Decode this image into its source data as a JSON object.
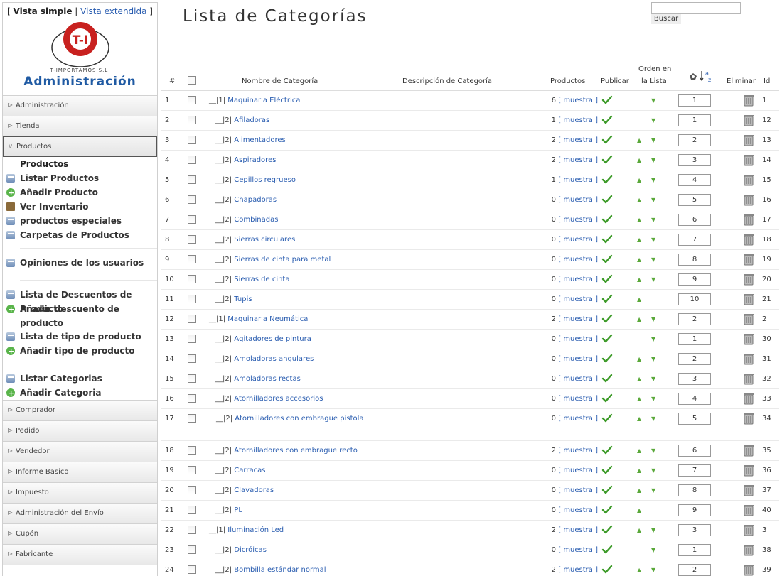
{
  "sidebar": {
    "view_left_bracket": "[",
    "view_simple": "Vista simple",
    "view_sep": "|",
    "view_extended": "Vista extendida",
    "view_right_bracket": "]",
    "logo_text": "T-I",
    "logo_sub": "T-IMPORTAMOS S.L.",
    "admin_title": "Administración",
    "sections_top": [
      {
        "label": "Administración"
      },
      {
        "label": "Tienda"
      }
    ],
    "open_section": "Productos",
    "open_section_title": "Productos",
    "product_items": [
      {
        "label": "Listar Productos",
        "icon": "page-icon"
      },
      {
        "label": "Añadir Producto",
        "icon": "add-icon"
      },
      {
        "label": "Ver Inventario",
        "icon": "inventory-icon"
      },
      {
        "label": "productos especiales",
        "icon": "page-icon"
      },
      {
        "label": "Carpetas de Productos",
        "icon": "page-icon"
      }
    ],
    "opinions_item": "Opiniones de los usuarios",
    "discount_items": [
      {
        "label": "Lista de Descuentos de Producto",
        "icon": "page-icon"
      },
      {
        "label": "Añadir descuento de producto",
        "icon": "add-icon"
      }
    ],
    "type_items": [
      {
        "label": "Lista de tipo de producto",
        "icon": "page-icon"
      },
      {
        "label": "Añadir tipo de producto",
        "icon": "add-icon"
      }
    ],
    "category_items": [
      {
        "label": "Listar Categorias",
        "icon": "page-icon"
      },
      {
        "label": "Añadir Categoria",
        "icon": "add-icon"
      }
    ],
    "sections_bottom": [
      {
        "label": "Comprador"
      },
      {
        "label": "Pedido"
      },
      {
        "label": "Vendedor"
      },
      {
        "label": "Informe Basico"
      },
      {
        "label": "Impuesto"
      },
      {
        "label": "Administración del Envío"
      },
      {
        "label": "Cupón"
      },
      {
        "label": "Fabricante"
      }
    ]
  },
  "header": {
    "title": "Lista de Categorías",
    "search_placeholder": "",
    "search_button": "Buscar"
  },
  "table": {
    "columns": {
      "num": "#",
      "name": "Nombre de Categoría",
      "description": "Descripción de Categoría",
      "products": "Productos",
      "publish": "Publicar",
      "order_line1": "Orden en",
      "order_line2": "la Lista",
      "delete": "Eliminar",
      "id": "Id"
    },
    "show_link": "[ muestra ]",
    "rows": [
      {
        "n": "1",
        "prefix": "__|1|",
        "name": "Maquinaria Eléctrica",
        "products": "6",
        "up": false,
        "down": true,
        "order": "1",
        "id": "1",
        "level": 1
      },
      {
        "n": "2",
        "prefix": "__|2|",
        "name": "Afiladoras",
        "products": "1",
        "up": false,
        "down": true,
        "order": "1",
        "id": "12",
        "level": 2
      },
      {
        "n": "3",
        "prefix": "__|2|",
        "name": "Alimentadores",
        "products": "2",
        "up": true,
        "down": true,
        "order": "2",
        "id": "13",
        "level": 2
      },
      {
        "n": "4",
        "prefix": "__|2|",
        "name": "Aspiradores",
        "products": "2",
        "up": true,
        "down": true,
        "order": "3",
        "id": "14",
        "level": 2
      },
      {
        "n": "5",
        "prefix": "__|2|",
        "name": "Cepillos regrueso",
        "products": "1",
        "up": true,
        "down": true,
        "order": "4",
        "id": "15",
        "level": 2
      },
      {
        "n": "6",
        "prefix": "__|2|",
        "name": "Chapadoras",
        "products": "0",
        "up": true,
        "down": true,
        "order": "5",
        "id": "16",
        "level": 2
      },
      {
        "n": "7",
        "prefix": "__|2|",
        "name": "Combinadas",
        "products": "0",
        "up": true,
        "down": true,
        "order": "6",
        "id": "17",
        "level": 2
      },
      {
        "n": "8",
        "prefix": "__|2|",
        "name": "Sierras circulares",
        "products": "0",
        "up": true,
        "down": true,
        "order": "7",
        "id": "18",
        "level": 2
      },
      {
        "n": "9",
        "prefix": "__|2|",
        "name": "Sierras de cinta para metal",
        "products": "0",
        "up": true,
        "down": true,
        "order": "8",
        "id": "19",
        "level": 2
      },
      {
        "n": "10",
        "prefix": "__|2|",
        "name": "Sierras de cinta",
        "products": "0",
        "up": true,
        "down": true,
        "order": "9",
        "id": "20",
        "level": 2
      },
      {
        "n": "11",
        "prefix": "__|2|",
        "name": "Tupis",
        "products": "0",
        "up": true,
        "down": false,
        "order": "10",
        "id": "21",
        "level": 2
      },
      {
        "n": "12",
        "prefix": "__|1|",
        "name": "Maquinaria Neumática",
        "products": "2",
        "up": true,
        "down": true,
        "order": "2",
        "id": "2",
        "level": 1
      },
      {
        "n": "13",
        "prefix": "__|2|",
        "name": "Agitadores de pintura",
        "products": "0",
        "up": false,
        "down": true,
        "order": "1",
        "id": "30",
        "level": 2
      },
      {
        "n": "14",
        "prefix": "__|2|",
        "name": "Amoladoras angulares",
        "products": "0",
        "up": true,
        "down": true,
        "order": "2",
        "id": "31",
        "level": 2
      },
      {
        "n": "15",
        "prefix": "__|2|",
        "name": "Amoladoras rectas",
        "products": "0",
        "up": true,
        "down": true,
        "order": "3",
        "id": "32",
        "level": 2
      },
      {
        "n": "16",
        "prefix": "__|2|",
        "name": "Atornilladores accesorios",
        "products": "0",
        "up": true,
        "down": true,
        "order": "4",
        "id": "33",
        "level": 2
      },
      {
        "n": "17",
        "prefix": "__|2|",
        "name": "Atornilladores con embrague pistola",
        "products": "0",
        "up": true,
        "down": true,
        "order": "5",
        "id": "34",
        "level": 2,
        "tall": true
      },
      {
        "n": "18",
        "prefix": "__|2|",
        "name": "Atornilladores con embrague recto",
        "products": "2",
        "up": true,
        "down": true,
        "order": "6",
        "id": "35",
        "level": 2
      },
      {
        "n": "19",
        "prefix": "__|2|",
        "name": "Carracas",
        "products": "0",
        "up": true,
        "down": true,
        "order": "7",
        "id": "36",
        "level": 2
      },
      {
        "n": "20",
        "prefix": "__|2|",
        "name": "Clavadoras",
        "products": "0",
        "up": true,
        "down": true,
        "order": "8",
        "id": "37",
        "level": 2
      },
      {
        "n": "21",
        "prefix": "__|2|",
        "name": "PL",
        "products": "0",
        "up": true,
        "down": false,
        "order": "9",
        "id": "40",
        "level": 2
      },
      {
        "n": "22",
        "prefix": "__|1|",
        "name": "Iluminación Led",
        "products": "2",
        "up": true,
        "down": true,
        "order": "3",
        "id": "3",
        "level": 1
      },
      {
        "n": "23",
        "prefix": "__|2|",
        "name": "Dicróicas",
        "products": "0",
        "up": false,
        "down": true,
        "order": "1",
        "id": "38",
        "level": 2
      },
      {
        "n": "24",
        "prefix": "__|2|",
        "name": "Bombilla estándar normal",
        "products": "2",
        "up": true,
        "down": true,
        "order": "2",
        "id": "39",
        "level": 2
      }
    ]
  }
}
